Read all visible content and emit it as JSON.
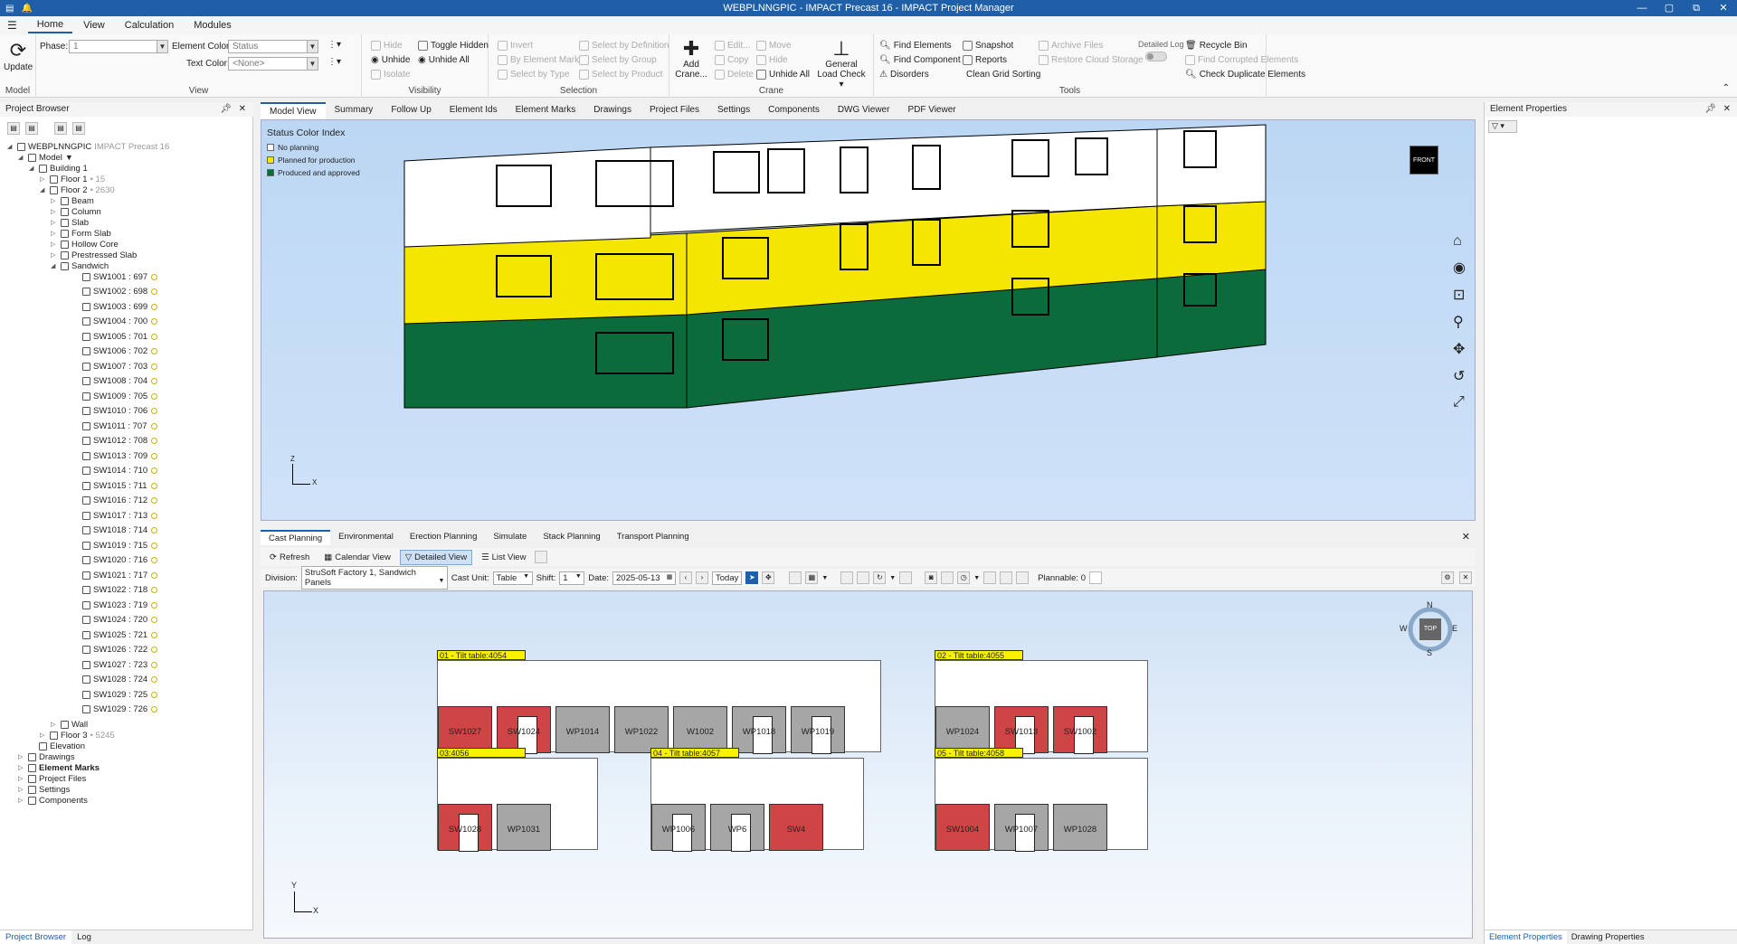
{
  "window": {
    "title": "WEBPLNNGPIC - IMPACT Precast 16 - IMPACT Project Manager",
    "controls": [
      "—",
      "▢",
      "⧉",
      "✕"
    ]
  },
  "menu": {
    "items": [
      "Home",
      "View",
      "Calculation",
      "Modules"
    ]
  },
  "ribbon": {
    "model": {
      "update": "Update",
      "label": "Model"
    },
    "view": {
      "phase_label": "Phase:",
      "phase_value": "1",
      "element_color_label": "Element Color:",
      "element_color_value": "Status",
      "text_color_label": "Text Color:",
      "text_color_value": "<None>",
      "label": "View"
    },
    "visibility": {
      "hide": "Hide",
      "unhide": "Unhide",
      "isolate": "Isolate",
      "toggle_hidden": "Toggle Hidden",
      "unhide_all": "Unhide All",
      "label": "Visibility"
    },
    "selection": {
      "invert": "Invert",
      "by_element_mark": "By Element Mark",
      "select_by_type": "Select by Type",
      "select_by_definition": "Select by Definition",
      "select_by_group": "Select by Group",
      "select_by_product": "Select by Product",
      "label": "Selection"
    },
    "crane": {
      "add_crane_1": "Add",
      "add_crane_2": "Crane...",
      "edit": "Edit...",
      "copy": "Copy",
      "delete": "Delete",
      "move": "Move",
      "hide": "Hide",
      "unhide_all": "Unhide All",
      "general_1": "General",
      "general_2": "Load Check ▾",
      "label": "Crane"
    },
    "tools": {
      "find_elements": "Find Elements",
      "find_component": "Find Component",
      "disorders": "Disorders",
      "snapshot": "Snapshot",
      "reports": "Reports",
      "clean_grid": "Clean Grid Sorting",
      "archive_files": "Archive Files",
      "restore_cloud": "Restore Cloud Storage",
      "detailed_log": "Detailed Log",
      "recycle_bin": "Recycle Bin",
      "find_corrupted": "Find Corrupted Elements",
      "check_duplicate": "Check Duplicate Elements",
      "label": "Tools"
    }
  },
  "project_browser": {
    "title": "Project Browser",
    "root": "WEBPLNNGPIC",
    "root_sub": "IMPACT Precast 16",
    "model": "Model",
    "building": "Building 1",
    "floor1": "Floor 1",
    "floor1_count": "• 15",
    "floor2": "Floor 2",
    "floor2_count": "• 2630",
    "categories": [
      "Beam",
      "Column",
      "Slab",
      "Form Slab",
      "Hollow Core",
      "Prestressed Slab",
      "Sandwich"
    ],
    "elements": [
      "SW1001 : 697",
      "SW1002 : 698",
      "SW1003 : 699",
      "SW1004 : 700",
      "SW1005 : 701",
      "SW1006 : 702",
      "SW1007 : 703",
      "SW1008 : 704",
      "SW1009 : 705",
      "SW1010 : 706",
      "SW1011 : 707",
      "SW1012 : 708",
      "SW1013 : 709",
      "SW1014 : 710",
      "SW1015 : 711",
      "SW1016 : 712",
      "SW1017 : 713",
      "SW1018 : 714",
      "SW1019 : 715",
      "SW1020 : 716",
      "SW1021 : 717",
      "SW1022 : 718",
      "SW1023 : 719",
      "SW1024 : 720",
      "SW1025 : 721",
      "SW1026 : 722",
      "SW1027 : 723",
      "SW1028 : 724",
      "SW1029 : 725",
      "SW1029 : 726"
    ],
    "wall": "Wall",
    "floor3": "Floor 3",
    "floor3_count": "• 5245",
    "elevation": "Elevation",
    "drawings": "Drawings",
    "element_marks": "Element Marks",
    "project_files": "Project Files",
    "settings": "Settings",
    "components": "Components",
    "tabs": [
      "Project Browser",
      "Log"
    ]
  },
  "doc_tabs": [
    "Model View",
    "Summary",
    "Follow Up",
    "Element Ids",
    "Element Marks",
    "Drawings",
    "Project Files",
    "Settings",
    "Components",
    "DWG Viewer",
    "PDF Viewer"
  ],
  "legend": {
    "title": "Status Color Index",
    "items": [
      {
        "label": "No planning",
        "color": "#ffffff"
      },
      {
        "label": "Planned for production",
        "color": "#f4e600"
      },
      {
        "label": "Produced and approved",
        "color": "#0b6b3a"
      }
    ]
  },
  "viewcube": {
    "label": "FRONT"
  },
  "axes": {
    "z": "Z",
    "x": "X",
    "y": "Y"
  },
  "bottom_tabs": [
    "Cast Planning",
    "Environmental",
    "Erection Planning",
    "Simulate",
    "Stack Planning",
    "Transport Planning"
  ],
  "toolbar1": {
    "refresh": "Refresh",
    "calendar": "Calendar View",
    "detailed": "Detailed View",
    "list": "List View"
  },
  "toolbar2": {
    "division_label": "Division:",
    "division": "StruSoft Factory 1, Sandwich Panels",
    "cast_unit_label": "Cast Unit:",
    "cast_unit": "Table",
    "shift_label": "Shift:",
    "shift": "1",
    "date_label": "Date:",
    "date": "2025-05-13",
    "today": "Today",
    "plannable": "Plannable: 0"
  },
  "compass": {
    "n": "N",
    "s": "S",
    "e": "E",
    "w": "W",
    "top": "TOP"
  },
  "plan_tables": [
    {
      "label": "01 - Tilt table:4054",
      "elements": [
        {
          "name": "SW1027",
          "color": "red",
          "win": false
        },
        {
          "name": "SW1024",
          "color": "red",
          "win": true
        },
        {
          "name": "WP1014",
          "color": "gray",
          "win": false
        },
        {
          "name": "WP1022",
          "color": "gray",
          "win": false
        },
        {
          "name": "W1002",
          "color": "gray",
          "win": false
        },
        {
          "name": "WP1018",
          "color": "gray",
          "win": true
        },
        {
          "name": "WP1019",
          "color": "gray",
          "win": true
        }
      ]
    },
    {
      "label": "02 - Tilt table:4055",
      "elements": [
        {
          "name": "WP1024",
          "color": "gray",
          "win": false
        },
        {
          "name": "SW1013",
          "color": "red",
          "win": true
        },
        {
          "name": "SW1002",
          "color": "red",
          "win": true
        }
      ]
    },
    {
      "label": "03:4056",
      "elements": [
        {
          "name": "SW1028",
          "color": "red",
          "win": true
        },
        {
          "name": "WP1031",
          "color": "gray",
          "win": false
        }
      ]
    },
    {
      "label": "04 - Tilt table:4057",
      "elements": [
        {
          "name": "WP1006",
          "color": "gray",
          "win": true
        },
        {
          "name": "WP6",
          "color": "gray",
          "win": true
        },
        {
          "name": "SW4",
          "color": "red",
          "win": false
        }
      ]
    },
    {
      "label": "05 - Tilt table:4058",
      "elements": [
        {
          "name": "SW1004",
          "color": "red",
          "win": false
        },
        {
          "name": "WP1007",
          "color": "gray",
          "win": true
        },
        {
          "name": "WP1028",
          "color": "gray",
          "win": false
        }
      ]
    }
  ],
  "element_properties": {
    "title": "Element Properties",
    "tabs": [
      "Element Properties",
      "Drawing Properties"
    ]
  }
}
